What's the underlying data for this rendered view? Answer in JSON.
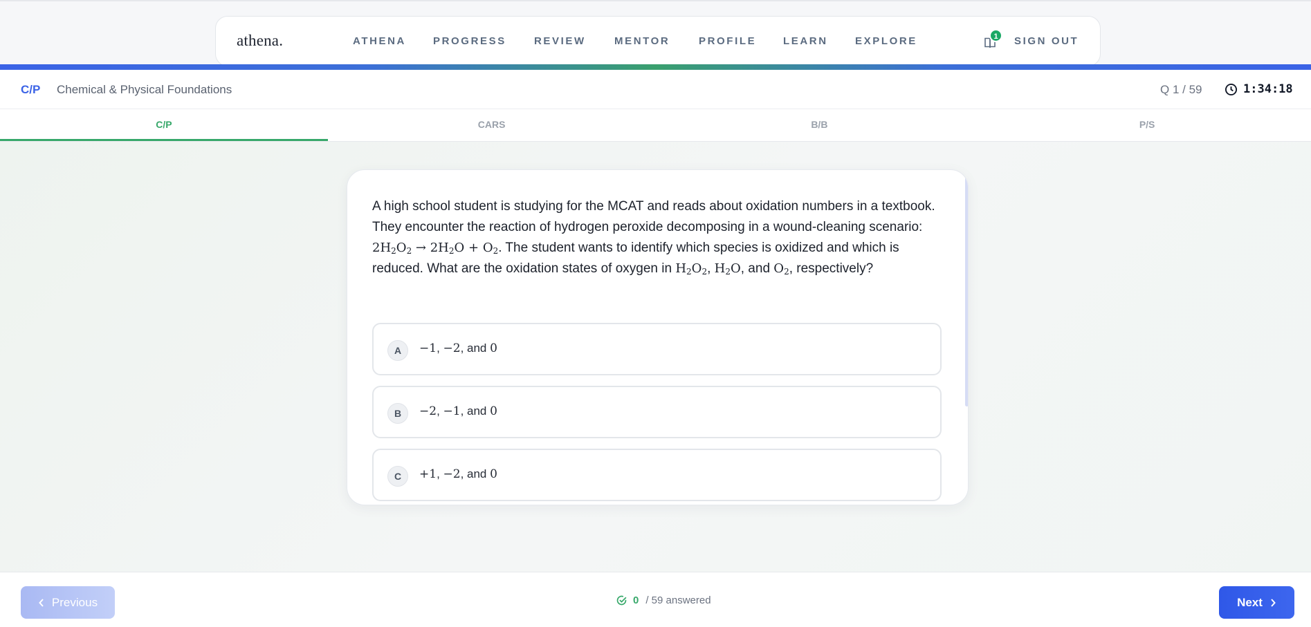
{
  "brand": {
    "logo": "athena."
  },
  "nav": {
    "items": [
      "ATHENA",
      "PROGRESS",
      "REVIEW",
      "MENTOR",
      "PROFILE",
      "LEARN",
      "EXPLORE"
    ],
    "notifications_count": "1",
    "sign_out": "SIGN OUT"
  },
  "section": {
    "code": "C/P",
    "name": "Chemical & Physical Foundations",
    "question_counter": "Q 1 / 59",
    "timer": "1:34:18"
  },
  "tabs": [
    {
      "label": "C/P",
      "active": true
    },
    {
      "label": "CARS",
      "active": false
    },
    {
      "label": "B/B",
      "active": false
    },
    {
      "label": "P/S",
      "active": false
    }
  ],
  "question": {
    "part1": "A high school student is studying for the MCAT and reads about oxidation numbers in a textbook. They encounter the reaction of hydrogen peroxide decomposing in a wound-cleaning scenario: ",
    "reaction": "2H₂O₂ → 2H₂O + O₂",
    "part2": ". The student wants to identify which species is oxidized and which is reduced. What are the oxidation states of oxygen in ",
    "species1": "H₂O₂",
    "sep1": ", ",
    "species2": "H₂O",
    "sep2": ", and ",
    "species3": "O₂",
    "part3": ", respectively?"
  },
  "options": [
    {
      "letter": "A",
      "v1": "−1",
      "v2": "−2",
      "v3": "0"
    },
    {
      "letter": "B",
      "v1": "−2",
      "v2": "−1",
      "v3": "0"
    },
    {
      "letter": "C",
      "v1": "+1",
      "v2": "−2",
      "v3": "0"
    }
  ],
  "option_joiners": {
    "comma": ", ",
    "and": ", and "
  },
  "footer": {
    "previous": "Previous",
    "next": "Next",
    "answered_count": "0",
    "answered_suffix": "/ 59 answered"
  },
  "colors": {
    "accent_blue": "#3b63e6",
    "accent_green": "#37a86a",
    "badge_green": "#1aa865"
  }
}
